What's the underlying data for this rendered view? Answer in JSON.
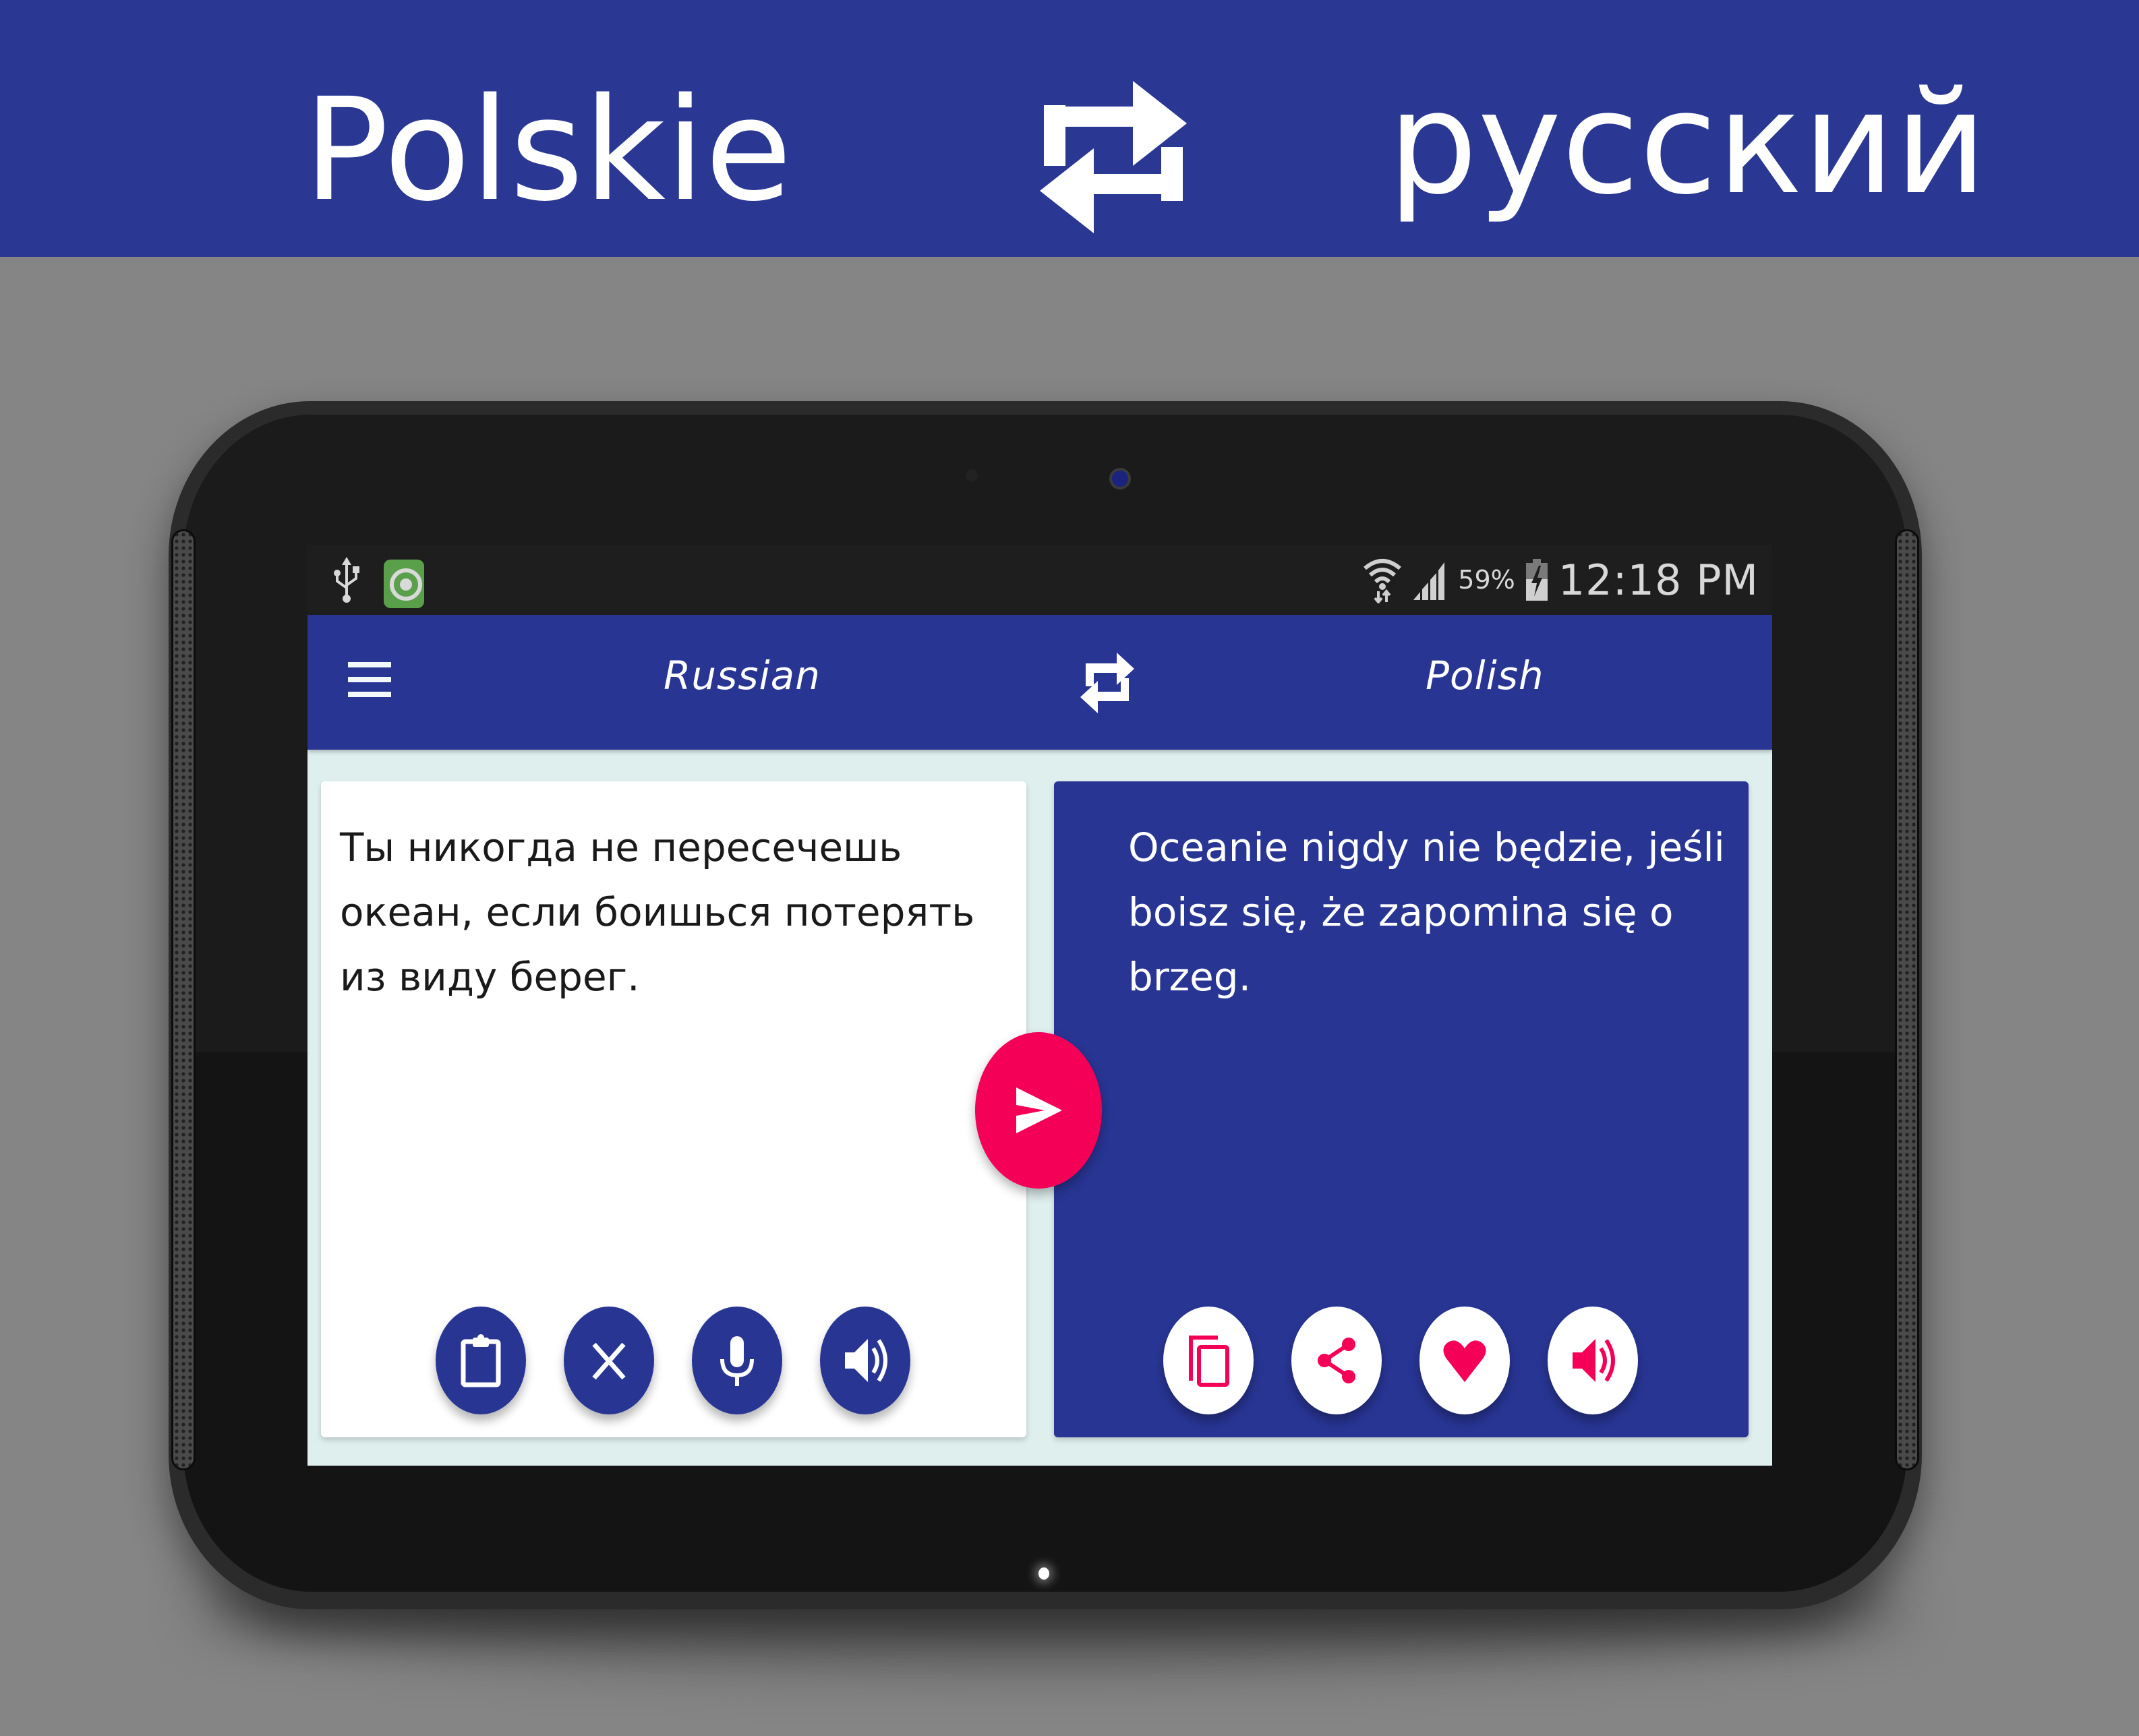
{
  "banner": {
    "left_language": "Polskie",
    "right_language": "русский",
    "swap_icon": "swap-arrows-icon"
  },
  "status_bar": {
    "left_icons": [
      "usb-icon",
      "app-notification-icon"
    ],
    "right_icons": [
      "wifi-icon",
      "signal-icon",
      "battery-charging-icon"
    ],
    "battery_percent": "59%",
    "time": "12:18 PM"
  },
  "app_bar": {
    "menu_icon": "hamburger-menu-icon",
    "source_language": "Russian",
    "swap_icon": "swap-arrows-icon",
    "target_language": "Polish"
  },
  "source_card": {
    "text": "Ты никогда не пересечешь океан, если боишься потерять из виду берег.",
    "actions": [
      {
        "name": "paste",
        "icon": "clipboard-icon"
      },
      {
        "name": "clear",
        "icon": "close-icon"
      },
      {
        "name": "voice-input",
        "icon": "microphone-icon"
      },
      {
        "name": "speak",
        "icon": "speaker-icon"
      }
    ]
  },
  "translate_button": {
    "icon": "send-icon"
  },
  "target_card": {
    "text": "Oceanie nigdy nie będzie, jeśli boisz się, że zapomina się o brzeg.",
    "actions": [
      {
        "name": "copy",
        "icon": "copy-icon"
      },
      {
        "name": "share",
        "icon": "share-icon"
      },
      {
        "name": "favorite",
        "icon": "heart-icon"
      },
      {
        "name": "speak",
        "icon": "speaker-icon"
      }
    ]
  },
  "colors": {
    "primary": "#283593",
    "accent": "#f50057",
    "background": "#858585",
    "content_background": "#dfefee",
    "banner": "#2a3894"
  }
}
